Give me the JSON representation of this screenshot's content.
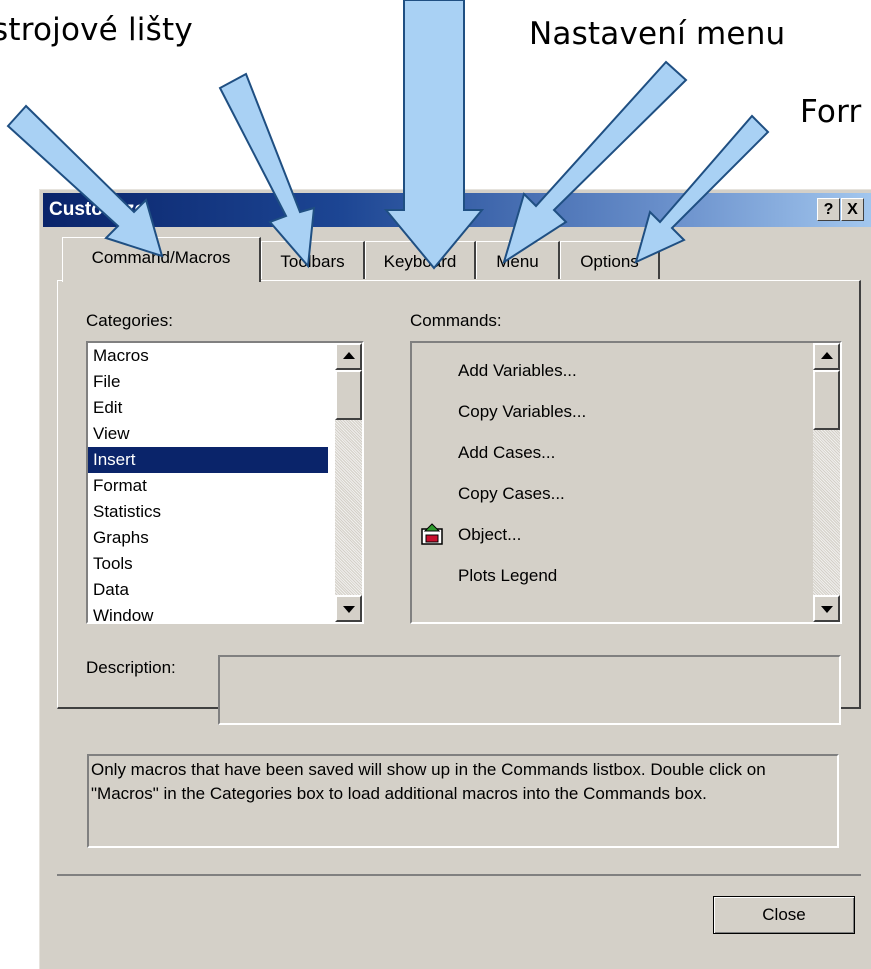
{
  "callouts": {
    "toolbars": "strojové lišty",
    "menu": "Nastavení menu",
    "format": "Forr"
  },
  "dialog": {
    "title": "Customize",
    "help_label": "?",
    "close_x_label": "X",
    "tabs": [
      {
        "label": "Command/Macros",
        "active": true
      },
      {
        "label": "Toolbars",
        "active": false
      },
      {
        "label": "Keyboard",
        "active": false
      },
      {
        "label": "Menu",
        "active": false
      },
      {
        "label": "Options",
        "active": false
      }
    ],
    "categories_label": "Categories:",
    "commands_label": "Commands:",
    "categories": [
      "Macros",
      "File",
      "Edit",
      "View",
      "Insert",
      "Format",
      "Statistics",
      "Graphs",
      "Tools",
      "Data",
      "Window"
    ],
    "selected_category": "Insert",
    "commands": [
      {
        "label": "Add Variables...",
        "icon": ""
      },
      {
        "label": "Copy Variables...",
        "icon": ""
      },
      {
        "label": "Add Cases...",
        "icon": ""
      },
      {
        "label": "Copy Cases...",
        "icon": ""
      },
      {
        "label": "Object...",
        "icon": "object-icon"
      },
      {
        "label": "Plots Legend",
        "icon": ""
      }
    ],
    "description_label": "Description:",
    "info_text": "Only macros that have been saved will show up in the Commands listbox. Double click on \"Macros\" in the Categories box to load additional macros into the Commands box.",
    "close_button_label": "Close"
  },
  "colors": {
    "dialog_face": "#d4d0c8",
    "title_bar": "#0a246a",
    "selection": "#0a246a",
    "arrow_fill": "#a9d1f4",
    "arrow_stroke": "#1f4f82"
  }
}
